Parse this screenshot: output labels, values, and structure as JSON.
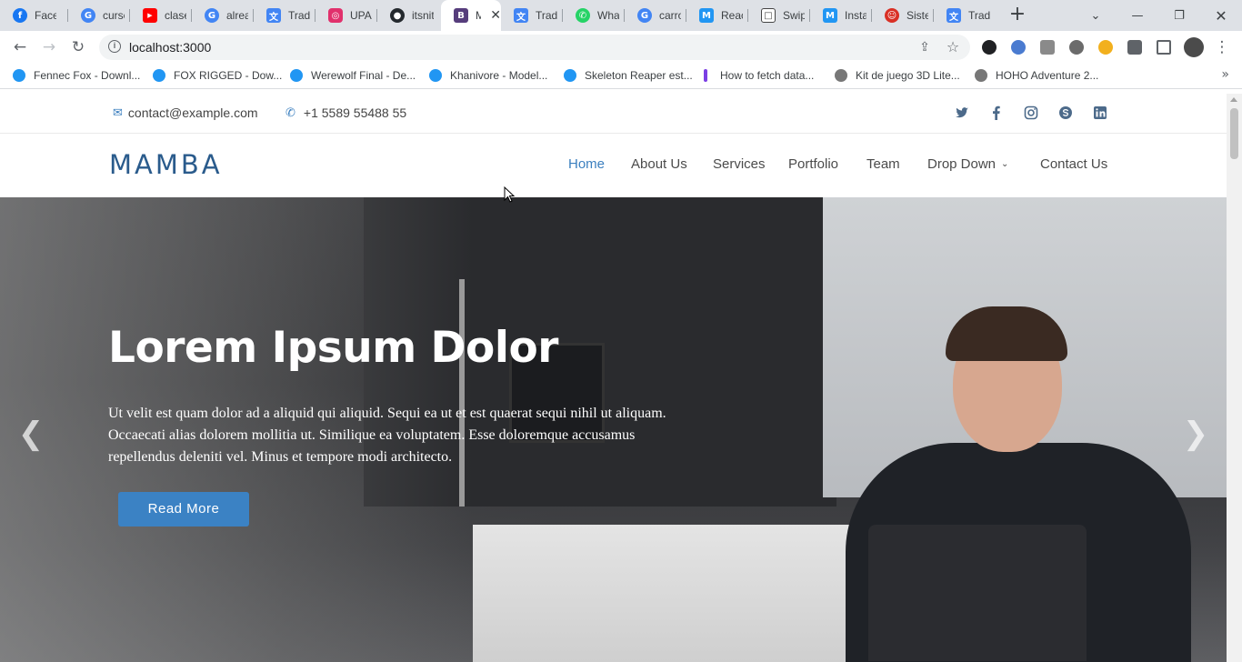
{
  "browser": {
    "tabs": [
      {
        "label": "Faceb",
        "fav_color": "#1877f2",
        "fav_glyph": "f"
      },
      {
        "label": "cursc",
        "fav_color": "#4285f4",
        "fav_glyph": "G"
      },
      {
        "label": "clase",
        "fav_color": "#ff0000",
        "fav_glyph": "▶"
      },
      {
        "label": "alrea",
        "fav_color": "#4285f4",
        "fav_glyph": "G"
      },
      {
        "label": "Tradu",
        "fav_color": "#4285f4",
        "fav_glyph": "文"
      },
      {
        "label": "UPAL",
        "fav_color": "#e1306c",
        "fav_glyph": "◎"
      },
      {
        "label": "itsnit",
        "fav_color": "#24292e",
        "fav_glyph": "●"
      },
      {
        "label": "M",
        "fav_color": "#563d7c",
        "fav_glyph": "B",
        "active": true
      },
      {
        "label": "Tradu",
        "fav_color": "#4285f4",
        "fav_glyph": "文"
      },
      {
        "label": "What",
        "fav_color": "#25d366",
        "fav_glyph": "✆"
      },
      {
        "label": "carro",
        "fav_color": "#4285f4",
        "fav_glyph": "G"
      },
      {
        "label": "React",
        "fav_color": "#2196f3",
        "fav_glyph": "M"
      },
      {
        "label": "Swipe",
        "fav_color": "#444444",
        "fav_glyph": "□"
      },
      {
        "label": "Instal",
        "fav_color": "#2196f3",
        "fav_glyph": "M"
      },
      {
        "label": "Sister",
        "fav_color": "#d93025",
        "fav_glyph": "☺"
      },
      {
        "label": "Tradu",
        "fav_color": "#4285f4",
        "fav_glyph": "文"
      }
    ],
    "close_glyph": "✕",
    "new_tab_glyph": "+",
    "tab_search_glyph": "⌄",
    "minimize_glyph": "—",
    "restore_glyph": "❐",
    "close_window_glyph": "✕",
    "back_glyph": "←",
    "forward_glyph": "→",
    "reload_glyph": "↻",
    "url": "localhost:3000",
    "info_glyph": "i",
    "share_glyph": "⇪",
    "star_glyph": "☆",
    "more_glyph": "⋮",
    "bookmarks": [
      {
        "label": "Fennec Fox - Downl...",
        "color": "#2196f3"
      },
      {
        "label": "FOX RIGGED - Dow...",
        "color": "#2196f3"
      },
      {
        "label": "Werewolf Final - De...",
        "color": "#2196f3"
      },
      {
        "label": "Khanivore - Model...",
        "color": "#2196f3"
      },
      {
        "label": "Skeleton Reaper est...",
        "color": "#2196f3"
      },
      {
        "label": "How to fetch data...",
        "color": "#7b3fe4"
      },
      {
        "label": "Kit de juego 3D Lite...",
        "color": "#777777"
      },
      {
        "label": "HOHO Adventure 2...",
        "color": "#777777"
      }
    ],
    "bookmarks_more": "»"
  },
  "site": {
    "email": "contact@example.com",
    "phone": "+1 5589 55488 55",
    "email_icon": "✉",
    "phone_icon": "✆",
    "logo": "MAMBA",
    "nav": [
      {
        "label": "Home",
        "active": true
      },
      {
        "label": "About Us"
      },
      {
        "label": "Services"
      },
      {
        "label": "Portfolio"
      },
      {
        "label": "Team"
      },
      {
        "label": "Drop Down",
        "dropdown": true
      },
      {
        "label": "Contact Us"
      }
    ],
    "dropdown_chevron": "⌄",
    "accent": "#3b7fbf"
  },
  "hero": {
    "title": "Lorem Ipsum Dolor",
    "text": "Ut velit est quam dolor ad a aliquid qui aliquid. Sequi ea ut et est quaerat sequi nihil ut aliquam. Occaecati alias dolorem mollitia ut. Similique ea voluptatem. Esse doloremque accusamus repellendus deleniti vel. Minus et tempore modi architecto.",
    "button": "Read More",
    "prev_glyph": "❮",
    "next_glyph": "❯",
    "button_color": "#3b82c4"
  }
}
